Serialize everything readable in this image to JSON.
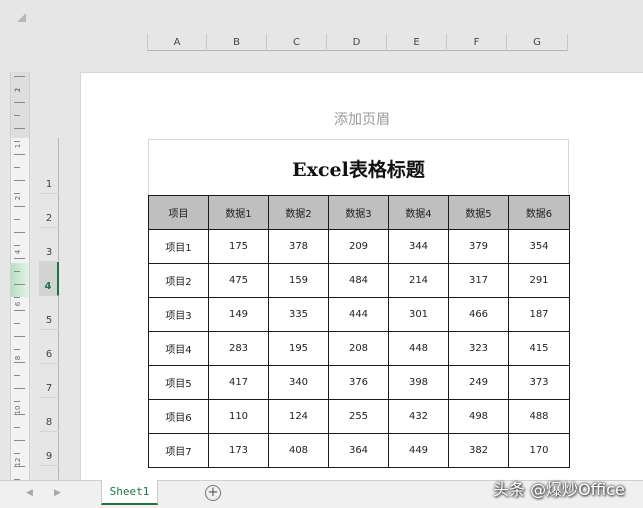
{
  "columns": [
    "A",
    "B",
    "C",
    "D",
    "E",
    "F",
    "G"
  ],
  "rows": [
    "1",
    "2",
    "3",
    "4",
    "5",
    "6",
    "7",
    "8",
    "9"
  ],
  "selected_row": "4",
  "ruler_labels": [
    "2",
    "1",
    "2",
    "4",
    "6",
    "8",
    "10",
    "12"
  ],
  "page": {
    "header_placeholder": "添加页眉",
    "title": "Excel表格标题"
  },
  "table": {
    "headers": [
      "项目",
      "数据1",
      "数据2",
      "数据3",
      "数据4",
      "数据5",
      "数据6"
    ],
    "rows": [
      [
        "项目1",
        "175",
        "378",
        "209",
        "344",
        "379",
        "354"
      ],
      [
        "项目2",
        "475",
        "159",
        "484",
        "214",
        "317",
        "291"
      ],
      [
        "项目3",
        "149",
        "335",
        "444",
        "301",
        "466",
        "187"
      ],
      [
        "项目4",
        "283",
        "195",
        "208",
        "448",
        "323",
        "415"
      ],
      [
        "项目5",
        "417",
        "340",
        "376",
        "398",
        "249",
        "373"
      ],
      [
        "项目6",
        "110",
        "124",
        "255",
        "432",
        "498",
        "488"
      ],
      [
        "项目7",
        "173",
        "408",
        "364",
        "449",
        "382",
        "170"
      ]
    ]
  },
  "sheet_tab": "Sheet1",
  "icons": {
    "add_sheet": "plus-circle-icon",
    "nav_prev": "chevron-left-icon",
    "nav_next": "chevron-right-icon"
  },
  "watermark": "头条 @爆炒Office",
  "colors": {
    "accent": "#217346",
    "header_fill": "#bfbfbf"
  }
}
